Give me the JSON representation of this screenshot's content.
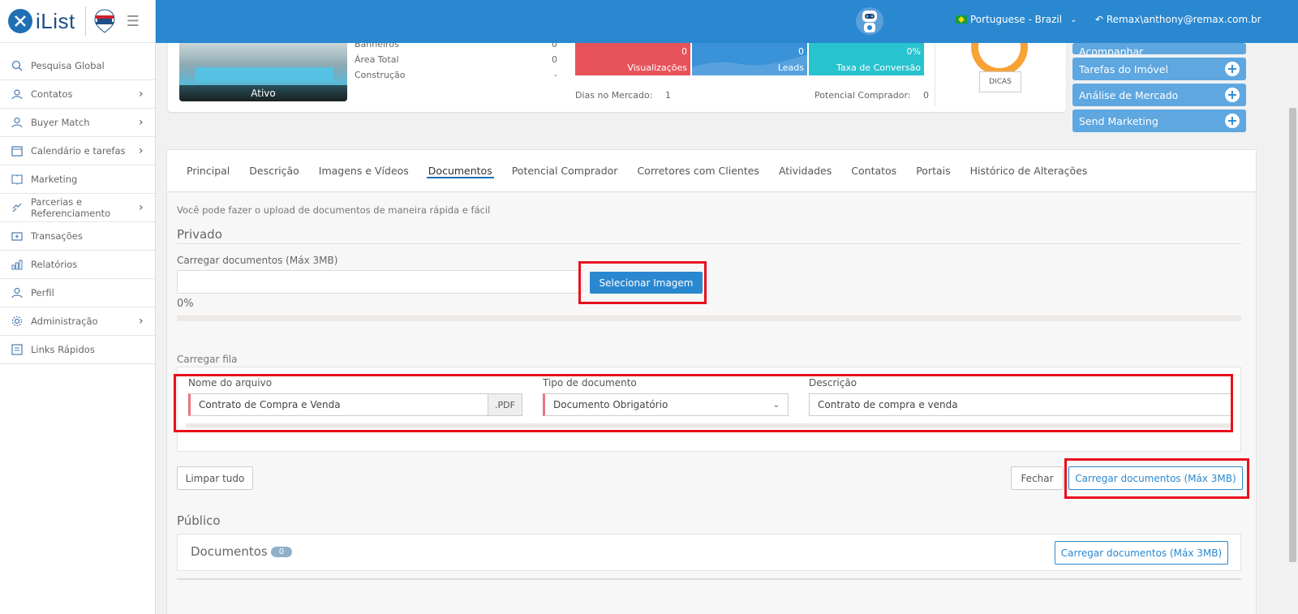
{
  "app": {
    "brand": "iList",
    "menu_toggle": "☰"
  },
  "sidebar": {
    "items": [
      {
        "label": "Pesquisa Global",
        "icon": "search-icon",
        "has_children": false
      },
      {
        "label": "Contatos",
        "icon": "contacts-icon",
        "has_children": true
      },
      {
        "label": "Buyer Match",
        "icon": "buyer-match-icon",
        "has_children": true
      },
      {
        "label": "Calendário e tarefas",
        "icon": "calendar-icon",
        "has_children": true
      },
      {
        "label": "Marketing",
        "icon": "marketing-icon",
        "has_children": false
      },
      {
        "label": "Parcerias e Referenciamento",
        "icon": "partnership-icon",
        "has_children": true
      },
      {
        "label": "Transações",
        "icon": "transactions-icon",
        "has_children": false
      },
      {
        "label": "Relatórios",
        "icon": "reports-icon",
        "has_children": false
      },
      {
        "label": "Perfil",
        "icon": "profile-icon",
        "has_children": false
      },
      {
        "label": "Administração",
        "icon": "settings-icon",
        "has_children": true
      },
      {
        "label": "Links Rápidos",
        "icon": "quick-links-icon",
        "has_children": false
      }
    ]
  },
  "topbar": {
    "language": "Portuguese - Brazil",
    "user": "Remax\\anthony@remax.com.br",
    "colors": {
      "bar": "#2a88d0"
    }
  },
  "property": {
    "status": "Ativo",
    "specs": [
      {
        "label": "Banheiros",
        "value": "0"
      },
      {
        "label": "Área Total",
        "value": "0"
      },
      {
        "label": "Construção",
        "value": "-"
      }
    ],
    "kpis": [
      {
        "label": "Visualizações",
        "value": "0",
        "color": "#e8525a"
      },
      {
        "label": "Leads",
        "value": "0",
        "color": "#3a92d9"
      },
      {
        "label": "Taxa de Conversão",
        "value": "0%",
        "color": "#27c3cf"
      }
    ],
    "days_label": "Dias no Mercado:",
    "days_value": "1",
    "buyer_label": "Potencial Comprador:",
    "buyer_value": "0",
    "dicas": "DICAS"
  },
  "side_actions": [
    {
      "label": "Acompanhar"
    },
    {
      "label": "Tarefas do Imóvel"
    },
    {
      "label": "Análise de Mercado"
    },
    {
      "label": "Send Marketing"
    }
  ],
  "tabs": [
    {
      "label": "Principal"
    },
    {
      "label": "Descrição"
    },
    {
      "label": "Imagens e Vídeos"
    },
    {
      "label": "Documentos",
      "active": true
    },
    {
      "label": "Potencial Comprador"
    },
    {
      "label": "Corretores com Clientes"
    },
    {
      "label": "Atividades"
    },
    {
      "label": "Contatos"
    },
    {
      "label": "Portais"
    },
    {
      "label": "Histórico de Alterações"
    }
  ],
  "documents": {
    "intro": "Você pode fazer o upload de documentos de maneira rápida e fácil",
    "private_title": "Privado",
    "upload_label": "Carregar documentos (Máx 3MB)",
    "select_button": "Selecionar Imagem",
    "progress_text": "0%",
    "progress": 0,
    "queue_label": "Carregar fila",
    "queue": {
      "file_name_label": "Nome do arquivo",
      "file_name_value": "Contrato de Compra e Venda",
      "extension": ".PDF",
      "doc_type_label": "Tipo de documento",
      "doc_type_value": "Documento Obrigatório",
      "description_label": "Descrição",
      "description_value": "Contrato de compra e venda"
    },
    "clear_button": "Limpar tudo",
    "close_button": "Fechar",
    "upload_button": "Carregar documentos (Máx 3MB)",
    "public_title": "Público",
    "public_docs_label": "Documentos",
    "public_docs_count": "0",
    "public_upload_button": "Carregar documentos (Máx 3MB)"
  }
}
